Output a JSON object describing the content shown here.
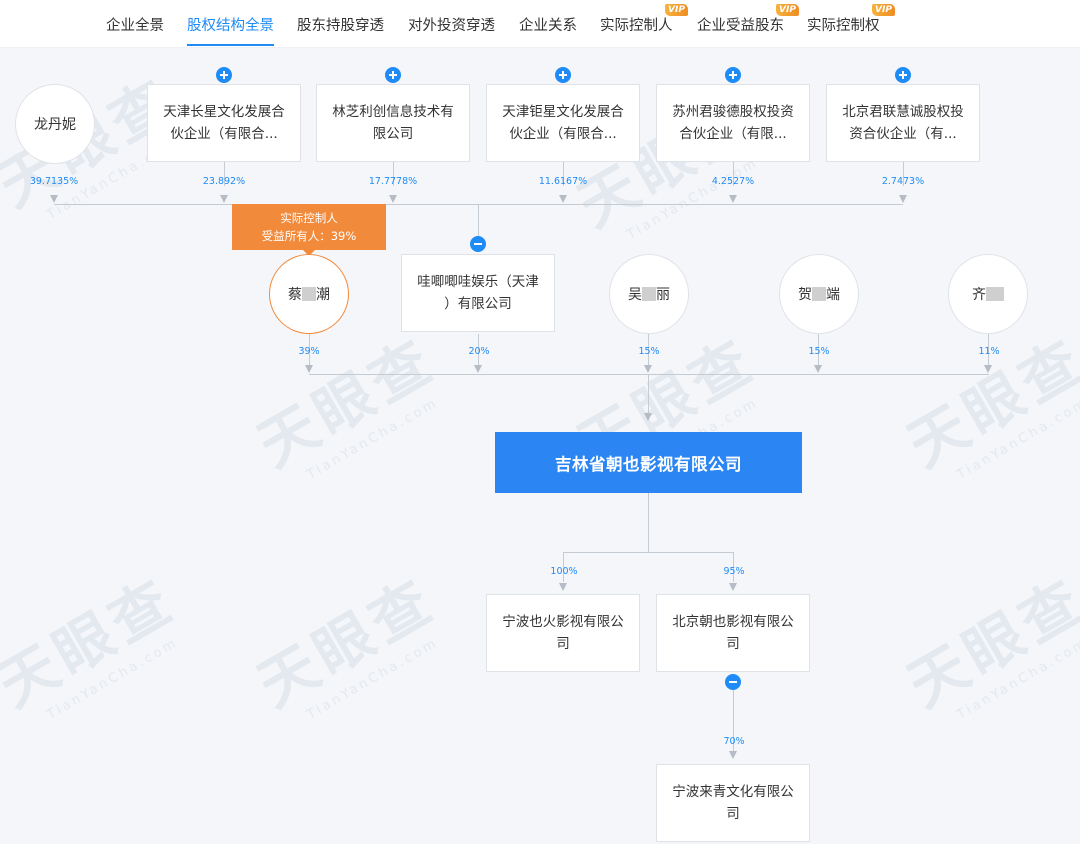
{
  "tabs": [
    {
      "label": "企业全景",
      "active": false,
      "vip": false
    },
    {
      "label": "股权结构全景",
      "active": true,
      "vip": false
    },
    {
      "label": "股东持股穿透",
      "active": false,
      "vip": false
    },
    {
      "label": "对外投资穿透",
      "active": false,
      "vip": false
    },
    {
      "label": "企业关系",
      "active": false,
      "vip": false
    },
    {
      "label": "实际控制人",
      "active": false,
      "vip": true
    },
    {
      "label": "企业受益股东",
      "active": false,
      "vip": true
    },
    {
      "label": "实际控制权",
      "active": false,
      "vip": true
    }
  ],
  "vip_badge": "VIP",
  "watermark": {
    "cn": "天眼查",
    "en": "TianYanCha.com"
  },
  "upper_shareholders": [
    {
      "name": "龙丹妮",
      "type": "person",
      "percent": "39.7135%"
    },
    {
      "line1": "天津长星文化发展合",
      "line2": "伙企业（有限合...",
      "type": "company",
      "percent": "23.892%",
      "expandable": true
    },
    {
      "line1": "林芝利创信息技术有",
      "line2": "限公司",
      "type": "company",
      "percent": "17.7778%",
      "expandable": true
    },
    {
      "line1": "天津钜星文化发展合",
      "line2": "伙企业（有限合...",
      "type": "company",
      "percent": "11.6167%",
      "expandable": true
    },
    {
      "line1": "苏州君骏德股权投资",
      "line2": "合伙企业（有限...",
      "type": "company",
      "percent": "4.2527%",
      "expandable": true
    },
    {
      "line1": "北京君联慧诚股权投",
      "line2": "资合伙企业（有...",
      "type": "company",
      "percent": "2.7473%",
      "expandable": true
    }
  ],
  "controller_tag": {
    "line1": "实际控制人",
    "line2": "受益所有人：39%"
  },
  "direct_shareholders": [
    {
      "name_prefix": "蔡",
      "name_suffix": "潮",
      "type": "person",
      "percent": "39%",
      "highlight": true
    },
    {
      "line1": "哇唧唧哇娱乐（天津",
      "line2": "）有限公司",
      "type": "company",
      "percent": "20%",
      "collapsible": true
    },
    {
      "name_prefix": "吴",
      "name_suffix": "丽",
      "type": "person",
      "percent": "15%"
    },
    {
      "name_prefix": "贺",
      "name_suffix": "端",
      "type": "person",
      "percent": "15%"
    },
    {
      "name_prefix": "齐",
      "name_suffix": "",
      "type": "person",
      "percent": "11%"
    }
  ],
  "center_company": "吉林省朝也影视有限公司",
  "subsidiaries": [
    {
      "line1": "宁波也火影视有限公",
      "line2": "司",
      "percent": "100%"
    },
    {
      "line1": "北京朝也影视有限公",
      "line2": "司",
      "percent": "95%",
      "collapsible": true
    }
  ],
  "sub_subsidiary": {
    "line1": "宁波来青文化有限公",
    "line2": "司",
    "percent": "70%"
  },
  "colors": {
    "accent": "#1f8bf7",
    "center_fill": "#2b86f4",
    "controller": "#f28a3c",
    "vip": "#f08c23"
  }
}
